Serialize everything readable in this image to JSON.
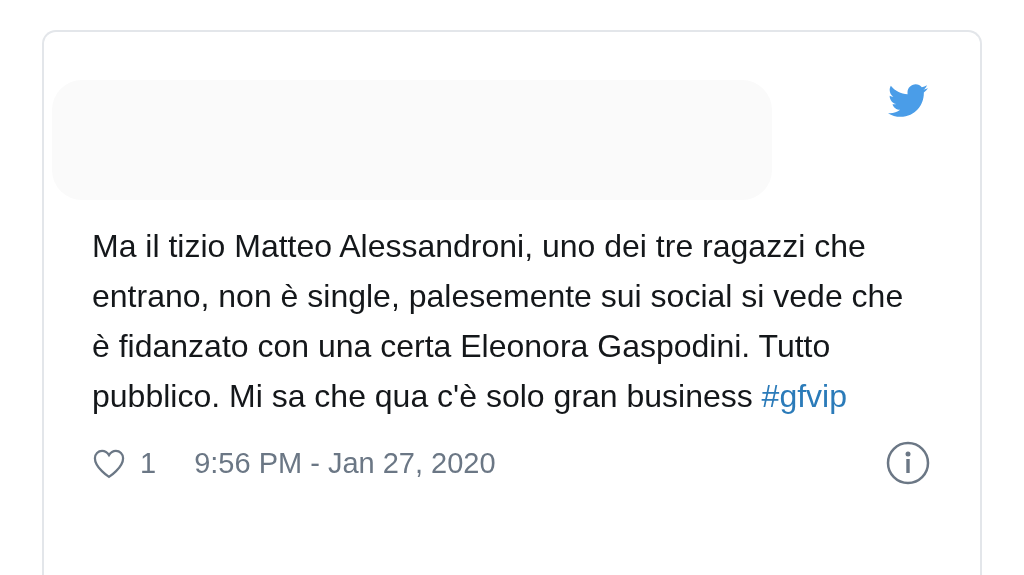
{
  "tweet": {
    "text": "Ma il tizio Matteo Alessandroni, uno dei tre ragazzi che entrano, non è single, palesemente sui social si vede che è fidanzato con una certa Eleonora Gaspodini. Tutto pubblico. Mi sa che qua c'è solo gran business",
    "hashtag": "#gfvip",
    "likes": "1",
    "timestamp": "9:56 PM - Jan 27, 2020"
  }
}
